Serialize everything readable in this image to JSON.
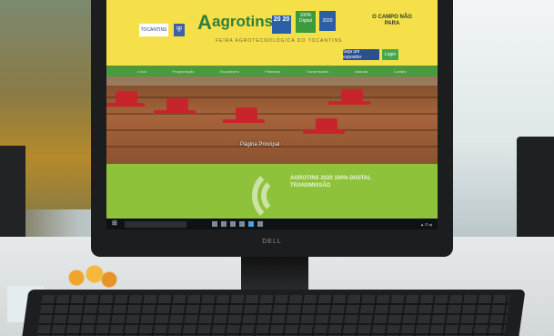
{
  "header": {
    "gov_logo": "TOCANTINS",
    "logo_brand": "agrotins",
    "logo_year": "20\n20",
    "badge_green": "100% Digital",
    "badge_blue": "2020",
    "subtitle": "FEIRA AGROTECNOLÓGICA DO TOCANTINS",
    "tagline": "O CAMPO NÃO PARA",
    "btn_primary": "Seja um expositor",
    "btn_secondary": "Login"
  },
  "nav": {
    "items": [
      "Início",
      "Programação",
      "Expositores",
      "Palestras",
      "Transmissões",
      "Notícias",
      "Contato"
    ]
  },
  "hero": {
    "caption": "Página Principal"
  },
  "banner": {
    "text": "AGROTINS 2020 100% DIGITAL TRANSMISSÃO"
  },
  "taskbar": {
    "start_icon": "windows-icon",
    "tray": "▲ ⊡ ◂)"
  },
  "monitor": {
    "brand": "DELL"
  },
  "colors": {
    "header_yellow": "#f6e04a",
    "nav_green": "#4b9a3e",
    "banner_green": "#8fc23b",
    "button_blue": "#2e4f8f"
  }
}
